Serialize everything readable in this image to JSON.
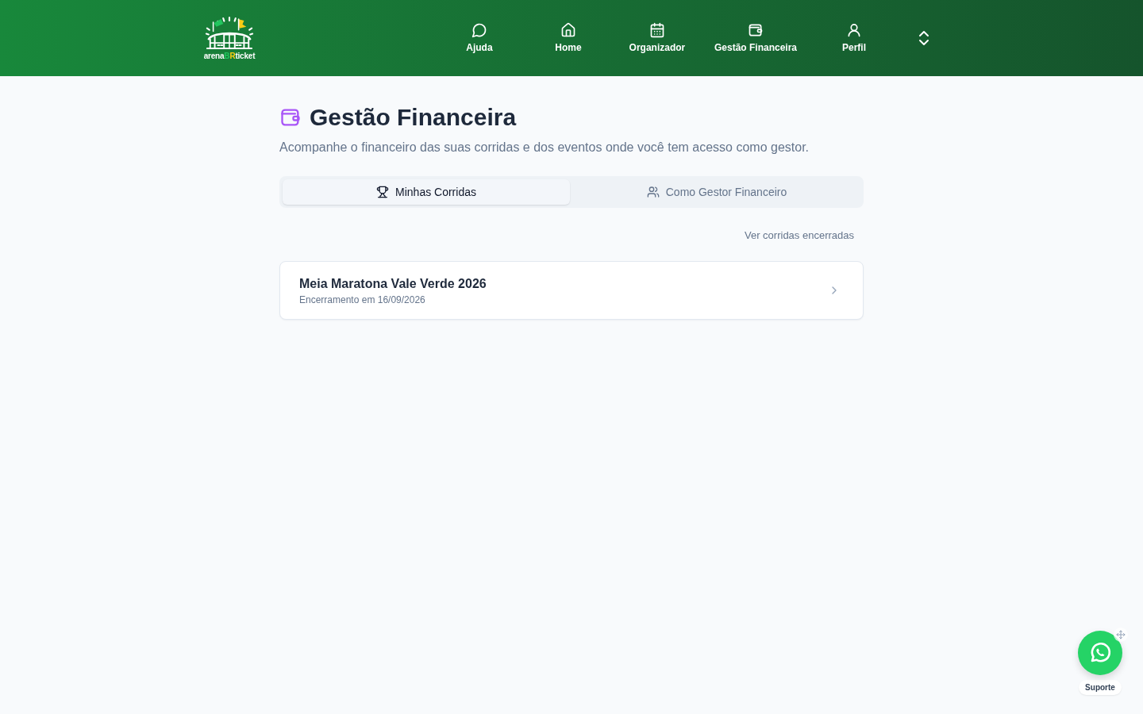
{
  "header": {
    "logo": {
      "parts": [
        {
          "text": "arena",
          "color": "#ffffff"
        },
        {
          "text": "B",
          "color": "#22c55e"
        },
        {
          "text": "R",
          "color": "#facc15"
        },
        {
          "text": "ticket",
          "color": "#ffffff"
        }
      ]
    },
    "nav": [
      {
        "label": "Ajuda"
      },
      {
        "label": "Home"
      },
      {
        "label": "Organizador"
      },
      {
        "label": "Gestão Financeira"
      },
      {
        "label": "Perfil"
      }
    ]
  },
  "page": {
    "title": "Gestão Financeira",
    "subtitle": "Acompanhe o financeiro das suas corridas e dos eventos onde você tem acesso como gestor."
  },
  "tabs": [
    {
      "label": "Minhas Corridas",
      "selected": true
    },
    {
      "label": "Como Gestor Financeiro",
      "selected": false
    }
  ],
  "closed_races_link": "Ver corridas encerradas",
  "races": [
    {
      "name": "Meia Maratona Vale Verde 2026",
      "closing": "Encerramento em 16/09/2026"
    }
  ],
  "support": {
    "label": "Suporte"
  }
}
